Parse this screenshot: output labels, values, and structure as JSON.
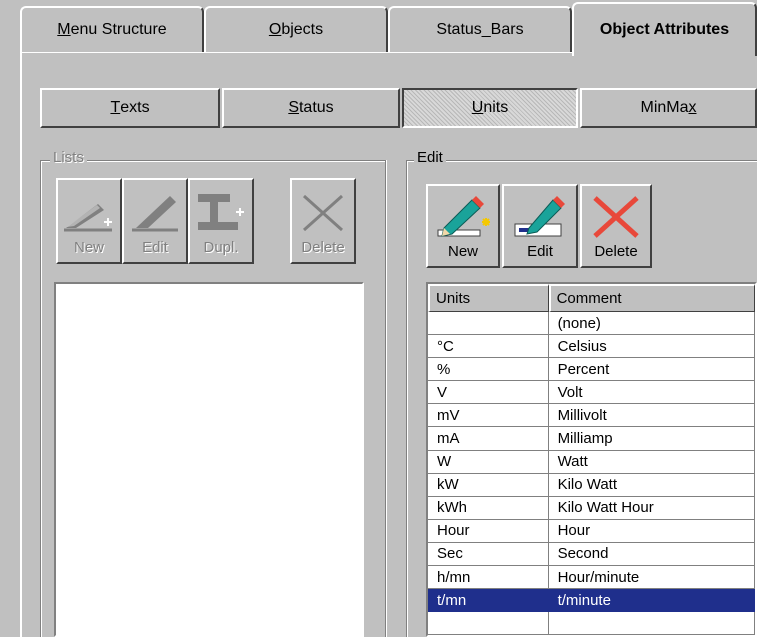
{
  "tabs": [
    {
      "label": "Menu Structure",
      "underline": "M",
      "rest": "enu Structure",
      "active": false
    },
    {
      "label": "Objects",
      "underline": "O",
      "rest": "bjects",
      "active": false
    },
    {
      "label": "Status_Bars",
      "underline": "",
      "rest": "Status_Bars",
      "active": false
    },
    {
      "label": "Object Attributes",
      "underline": "",
      "rest": "Object Attributes",
      "active": true
    }
  ],
  "subtabs": {
    "texts": {
      "u": "T",
      "rest": "exts"
    },
    "status": {
      "u": "S",
      "rest": "tatus"
    },
    "units": {
      "u": "U",
      "rest": "nits"
    },
    "minmax": {
      "pre": "MinMa",
      "u": "x"
    }
  },
  "lists_group": {
    "label": "Lists",
    "buttons": {
      "new": "New",
      "edit": "Edit",
      "dupl": "Dupl.",
      "delete": "Delete"
    }
  },
  "edit_group": {
    "label": "Edit",
    "buttons": {
      "new": "New",
      "edit": "Edit",
      "delete": "Delete"
    }
  },
  "units_table": {
    "headers": {
      "units": "Units",
      "comment": "Comment"
    },
    "rows": [
      {
        "unit": "",
        "comment": "(none)"
      },
      {
        "unit": "°C",
        "comment": "Celsius"
      },
      {
        "unit": "%",
        "comment": "Percent"
      },
      {
        "unit": "V",
        "comment": "Volt"
      },
      {
        "unit": "mV",
        "comment": "Millivolt"
      },
      {
        "unit": "mA",
        "comment": "Milliamp"
      },
      {
        "unit": "W",
        "comment": "Watt"
      },
      {
        "unit": "kW",
        "comment": "Kilo Watt"
      },
      {
        "unit": "kWh",
        "comment": "Kilo Watt Hour"
      },
      {
        "unit": "Hour",
        "comment": "Hour"
      },
      {
        "unit": "Sec",
        "comment": "Second"
      },
      {
        "unit": "h/mn",
        "comment": "Hour/minute"
      },
      {
        "unit": "t/mn",
        "comment": "t/minute",
        "selected": true
      },
      {
        "unit": "",
        "comment": ""
      }
    ]
  },
  "colors": {
    "selection": "#1f2f8c",
    "face": "#c0c0c0"
  }
}
